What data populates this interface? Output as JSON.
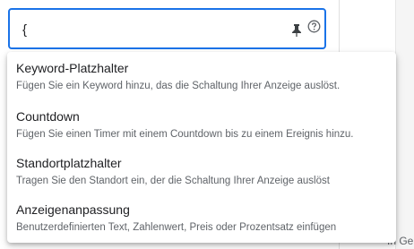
{
  "input": {
    "value": "{",
    "pin_icon": "pin-icon",
    "help_icon": "help-icon",
    "accent_color": "#1a73e8"
  },
  "dropdown": {
    "options": [
      {
        "title": "Keyword-Platzhalter",
        "description": "Fügen Sie ein Keyword hinzu, das die Schaltung Ihrer Anzeige auslöst."
      },
      {
        "title": "Countdown",
        "description": "Fügen Sie einen Timer mit einem Countdown bis zu einem Ereignis hinzu."
      },
      {
        "title": "Standortplatzhalter",
        "description": "Tragen Sie den Standort ein, der die Schaltung Ihrer Anzeige auslöst"
      },
      {
        "title": "Anzeigenanpassung",
        "description": "Benutzerdefinierten Text, Zahlenwert, Preis oder Prozentsatz einfügen"
      }
    ]
  },
  "background": {
    "cut_text": "In Ge"
  }
}
